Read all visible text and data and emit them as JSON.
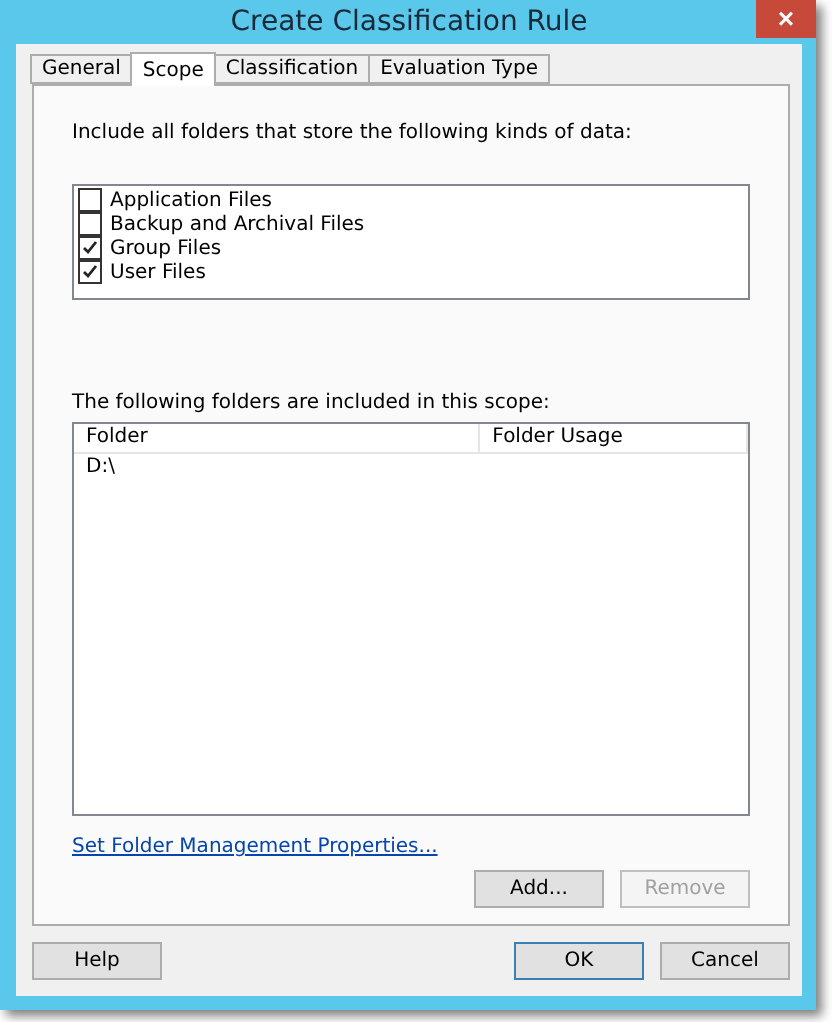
{
  "window": {
    "title": "Create Classification Rule",
    "close_glyph": "×"
  },
  "tabs": [
    {
      "label": "General",
      "selected": false
    },
    {
      "label": "Scope",
      "selected": true
    },
    {
      "label": "Classification",
      "selected": false
    },
    {
      "label": "Evaluation Type",
      "selected": false
    }
  ],
  "data_kinds_label": "Include all folders that store the following kinds of data:",
  "data_kinds": [
    {
      "label": "Application Files",
      "checked": false
    },
    {
      "label": "Backup and Archival Files",
      "checked": false
    },
    {
      "label": "Group Files",
      "checked": true
    },
    {
      "label": "User Files",
      "checked": true
    }
  ],
  "folders_label": "The following folders are included in this scope:",
  "table": {
    "columns": [
      "Folder",
      "Folder Usage"
    ],
    "rows": [
      [
        "D:\\",
        ""
      ]
    ]
  },
  "link": "Set Folder Management Properties...",
  "list_buttons": [
    {
      "label": "Add...",
      "disabled": false
    },
    {
      "label": "Remove",
      "disabled": true
    }
  ],
  "buttons": [
    {
      "label": "Help",
      "default": false
    },
    {
      "label": "OK",
      "default": true
    },
    {
      "label": "Cancel",
      "default": false
    }
  ]
}
